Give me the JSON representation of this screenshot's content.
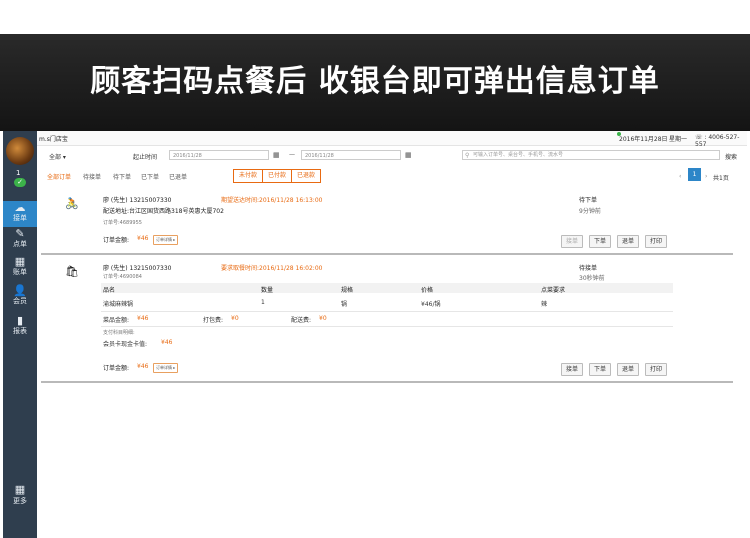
{
  "banner": {
    "title": "顾客扫码点餐后 收银台即可弹出信息订单"
  },
  "sidebar": {
    "badge_count": "1",
    "items": [
      {
        "label": "接单",
        "icon": "cloud-download-icon",
        "glyph": "☁"
      },
      {
        "label": "点单",
        "icon": "edit-icon",
        "glyph": "✎"
      },
      {
        "label": "账单",
        "icon": "grid-icon",
        "glyph": "▦"
      },
      {
        "label": "会员",
        "icon": "user-icon",
        "glyph": "👤"
      },
      {
        "label": "报表",
        "icon": "bar-chart-icon",
        "glyph": "▮"
      }
    ],
    "more_label": "更多"
  },
  "topbar": {
    "store_name": "m.s门店宝",
    "date": "2016年11月28日",
    "weekday": "星期一",
    "phone": "4006-527-557"
  },
  "filter": {
    "scope": "全部 ▾",
    "start_label": "起止时间",
    "start_date": "2016/11/28",
    "end_date": "2016/11/28",
    "search_placeholder": "可输入订单号、桌台号、手机号、流水号",
    "search_button": "搜索"
  },
  "tabs": [
    {
      "label": "全部订单",
      "active": true
    },
    {
      "label": "待接单",
      "active": false
    },
    {
      "label": "待下单",
      "active": false
    },
    {
      "label": "已下单",
      "active": false
    },
    {
      "label": "已退单",
      "active": false
    }
  ],
  "pay_filters": [
    "未付款",
    "已付款",
    "已退款"
  ],
  "pager": {
    "prev": "‹",
    "current": "1",
    "next": "›",
    "total": "共1页"
  },
  "orders": [
    {
      "icon": "delivery-bike-icon",
      "glyph": "🚴",
      "customer": "廖 (先生)  13215007330",
      "time_label": "期望送达时间:2016/11/28 16:13:00",
      "address": "配送地址:台江区国货西路318号英惠大厦702",
      "order_no": "订单号:4689955",
      "status": "待下单",
      "ago": "9分钟前",
      "total_label": "订单金额:",
      "total_value": "¥46",
      "detail_button": "订单详情 ▸",
      "actions": [
        "接单",
        "下单",
        "退单",
        "打印"
      ]
    },
    {
      "icon": "shopping-bag-icon",
      "glyph": "🛍",
      "customer": "廖 (先生)  13215007330",
      "time_label": "要求取餐时间:2016/11/28 16:02:00",
      "order_no": "订单号:4690084",
      "status": "待接单",
      "ago": "30秒钟前",
      "columns": [
        "品名",
        "数量",
        "规格",
        "价格",
        "点菜要求"
      ],
      "items": [
        {
          "name": "渝城麻辣锅",
          "qty": "1",
          "spec": "锅",
          "price": "¥46/锅",
          "req": "辣"
        }
      ],
      "dish_amount_label": "菜品金额:",
      "dish_amount": "¥46",
      "pack_fee_label": "打包费:",
      "pack_fee": "¥0",
      "delivery_fee_label": "配送费:",
      "delivery_fee": "¥0",
      "pay_detail_label": "支付科目明细:",
      "member_card_label": "会员卡现金卡值:",
      "member_card_value": "¥46",
      "total_label": "订单金额:",
      "total_value": "¥46",
      "detail_button": "订单详情 ▸",
      "actions": [
        "接单",
        "下单",
        "退单",
        "打印"
      ]
    }
  ]
}
